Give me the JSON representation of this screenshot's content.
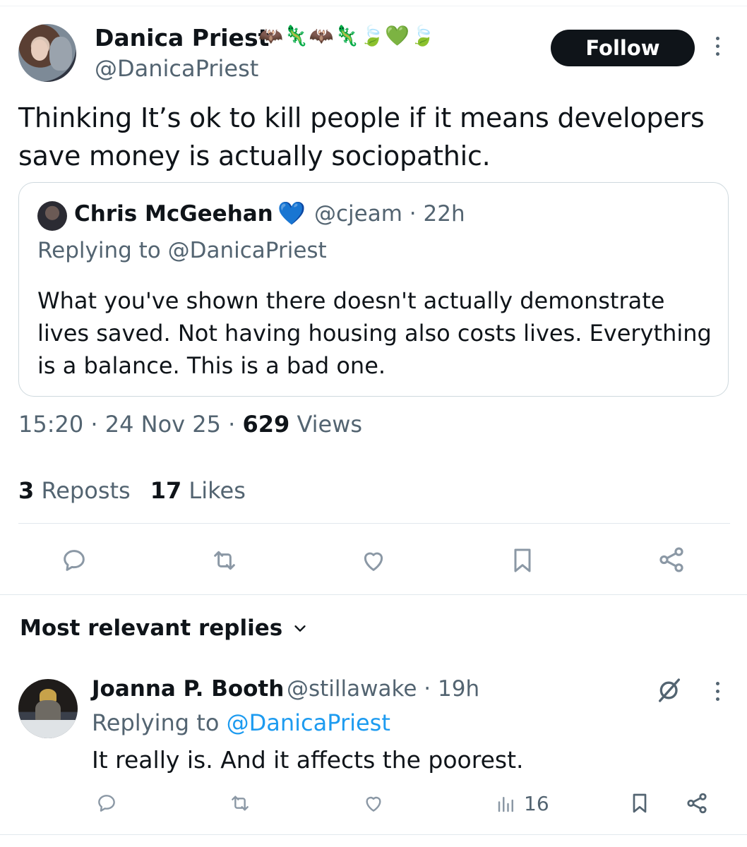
{
  "tweet": {
    "author": {
      "name": "Danica Priest",
      "name_emojis": "🦇🦎🦇🦎🍃💚🍃",
      "handle": "@DanicaPriest"
    },
    "follow_label": "Follow",
    "text": "Thinking It’s ok to kill people if it means developers save money is actually sociopathic.",
    "quoted": {
      "author_name": "Chris McGeehan",
      "verified_emoji": "💙",
      "handle": "@cjeam",
      "time": "22h",
      "replying_prefix": "Replying to",
      "replying_to": "@DanicaPriest",
      "text": "What you've shown there doesn't actually demonstrate lives saved. Not having housing also costs lives. Everything is a balance. This is a bad one."
    },
    "time": "15:20",
    "date": "24 Nov 25",
    "views_count": "629",
    "views_label": "Views",
    "reposts_count": "3",
    "reposts_label": "Reposts",
    "likes_count": "17",
    "likes_label": "Likes"
  },
  "replies_section": {
    "heading": "Most relevant replies"
  },
  "reply": {
    "author_name": "Joanna P. Booth",
    "handle": "@stillawake",
    "time": "19h",
    "replying_prefix": "Replying to",
    "replying_to": "@DanicaPriest",
    "text": "It really is. And it affects the poorest.",
    "views_count": "16"
  },
  "icons": {
    "main_actions": [
      "reply-icon",
      "repost-icon",
      "like-icon",
      "bookmark-icon",
      "share-icon"
    ],
    "reply_actions": [
      "reply-icon",
      "repost-icon",
      "like-icon",
      "views-icon",
      "bookmark-icon",
      "share-icon"
    ],
    "other": [
      "more-icon",
      "grok-icon",
      "chevron-down-icon"
    ]
  },
  "colors": {
    "text_primary": "#0f1419",
    "text_secondary": "#536471",
    "link": "#1d9bf0",
    "follow_button_bg": "#0f1419",
    "border": "#cfd9de",
    "verified_heart": "#1d6fd8"
  }
}
